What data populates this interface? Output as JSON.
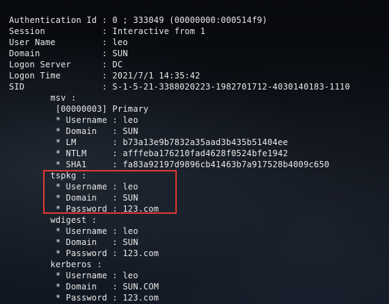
{
  "terminal": {
    "lines": [
      "Authentication Id : 0 ; 333049 (00000000:000514f9)",
      "Session           : Interactive from 1",
      "User Name         : leo",
      "Domain            : SUN",
      "Logon Server      : DC",
      "Logon Time        : 2021/7/1 14:35:42",
      "SID               : S-1-5-21-3388020223-1982701712-4030140183-1110",
      "        msv :",
      "         [00000003] Primary",
      "         * Username : leo",
      "         * Domain   : SUN",
      "         * LM       : b73a13e9b7832a35aad3b435b51404ee",
      "         * NTLM     : afffeba176210fad4628f0524bfe1942",
      "         * SHA1     : fa83a92197d9896cb41463b7a917528b4009c650",
      "        tspkg :",
      "         * Username : leo",
      "         * Domain   : SUN",
      "         * Password : 123.com",
      "        wdigest :",
      "         * Username : leo",
      "         * Domain   : SUN",
      "         * Password : 123.com",
      "        kerberos :",
      "         * Username : leo",
      "         * Domain   : SUN.COM",
      "         * Password : 123.com"
    ]
  },
  "highlight": {
    "color": "#e53935"
  }
}
